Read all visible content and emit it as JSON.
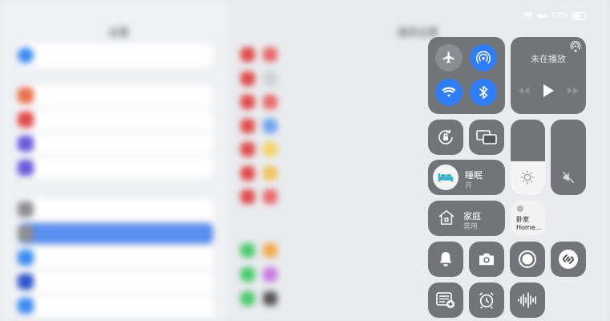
{
  "status_bar": {
    "battery_percent": "67%",
    "battery_level": 0.67
  },
  "settings_background": {
    "title_left": "设置",
    "title_right": "通用设置"
  },
  "control_center": {
    "now_playing": {
      "status": "未在播放"
    },
    "sleep": {
      "title": "睡眠",
      "state": "开"
    },
    "home": {
      "title": "家庭",
      "subtitle": "常用"
    },
    "home_accessory": {
      "room": "卧室",
      "name": "Home..."
    },
    "brightness_level": 0.45,
    "volume_level": 0.0
  },
  "colors": {
    "accent_blue": "#2f7df6",
    "tile_bg": "#55575c"
  },
  "icons": [
    "airplane-icon",
    "airdrop-icon",
    "wifi-icon",
    "bluetooth-icon",
    "airplay-icon",
    "rewind-icon",
    "play-icon",
    "forward-icon",
    "rotation-lock-icon",
    "screen-mirroring-icon",
    "brightness-icon",
    "mute-icon",
    "bed-icon",
    "home-icon",
    "bulb-icon",
    "bell-icon",
    "camera-icon",
    "record-icon",
    "shazam-icon",
    "notes-icon",
    "alarm-icon",
    "voice-memo-icon"
  ]
}
